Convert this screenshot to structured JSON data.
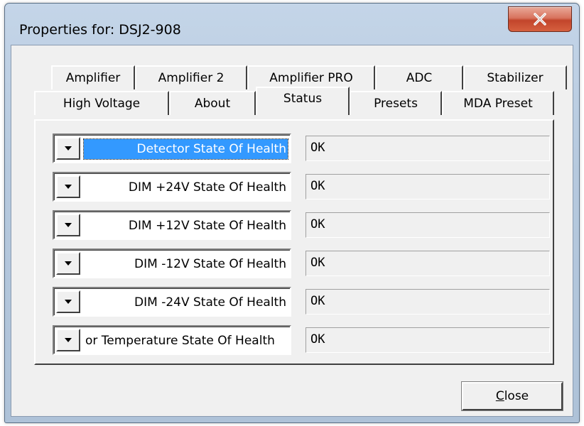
{
  "window": {
    "title": "Properties for: DSJ2-908"
  },
  "tabs_row1": [
    {
      "label": "Amplifier"
    },
    {
      "label": "Amplifier 2"
    },
    {
      "label": "Amplifier PRO"
    },
    {
      "label": "ADC"
    },
    {
      "label": "Stabilizer"
    }
  ],
  "tabs_row2": [
    {
      "label": "High Voltage"
    },
    {
      "label": "About"
    },
    {
      "label": "Status",
      "selected": true
    },
    {
      "label": "Presets"
    },
    {
      "label": "MDA Preset"
    }
  ],
  "status_rows": [
    {
      "label": "Detector State Of Health",
      "value": "OK"
    },
    {
      "label": "DIM +24V State Of Health",
      "value": "OK"
    },
    {
      "label": "DIM +12V State Of Health",
      "value": "OK"
    },
    {
      "label": "DIM -12V State Of Health",
      "value": "OK"
    },
    {
      "label": "DIM -24V State Of Health",
      "value": "OK"
    },
    {
      "label": "or Temperature State Of Health",
      "value": "OK"
    }
  ],
  "buttons": {
    "close_accel": "C",
    "close_rest": "lose"
  },
  "colors": {
    "selection": "#3399ff",
    "close_x": "#c2452b"
  }
}
